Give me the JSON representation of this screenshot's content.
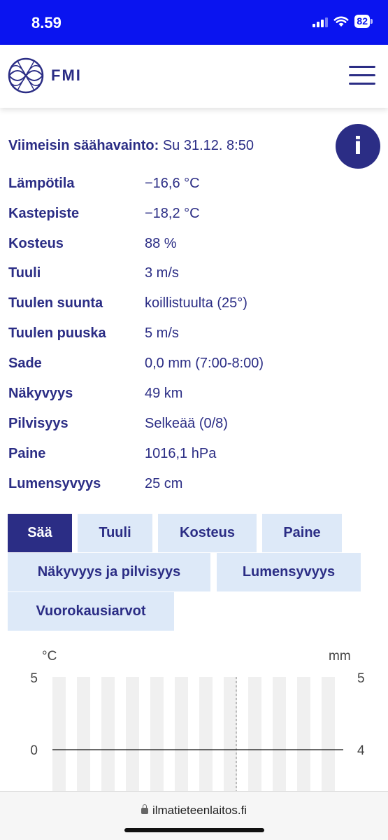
{
  "status_bar": {
    "time": "8.59",
    "battery": "82"
  },
  "header": {
    "logo_text": "FMI"
  },
  "observation": {
    "title_label": "Viimeisin säähavainto:",
    "title_value": "Su 31.12. 8:50",
    "rows": [
      {
        "label": "Lämpötila",
        "value": "−16,6 °C"
      },
      {
        "label": "Kastepiste",
        "value": "−18,2 °C"
      },
      {
        "label": "Kosteus",
        "value": "88 %"
      },
      {
        "label": "Tuuli",
        "value": "3 m/s"
      },
      {
        "label": "Tuulen suunta",
        "value": "koillistuulta (25°)"
      },
      {
        "label": "Tuulen puuska",
        "value": "5 m/s"
      },
      {
        "label": "Sade",
        "value": "0,0 mm (7:00-8:00)"
      },
      {
        "label": "Näkyvyys",
        "value": "49 km"
      },
      {
        "label": "Pilvisyys",
        "value": "Selkeää (0/8)"
      },
      {
        "label": "Paine",
        "value": "1016,1 hPa"
      },
      {
        "label": "Lumensyvyys",
        "value": "25 cm"
      }
    ]
  },
  "tabs": [
    {
      "label": "Sää",
      "active": true
    },
    {
      "label": "Tuuli",
      "active": false
    },
    {
      "label": "Kosteus",
      "active": false
    },
    {
      "label": "Paine",
      "active": false
    },
    {
      "label": "Näkyvyys ja pilvisyys",
      "active": false
    },
    {
      "label": "Lumensyvyys",
      "active": false
    },
    {
      "label": "Vuorokausiarvot",
      "active": false
    }
  ],
  "chart_data": {
    "type": "line",
    "left_unit": "°C",
    "right_unit": "mm",
    "left_ticks": [
      "5",
      "0"
    ],
    "right_ticks": [
      "5",
      "4"
    ],
    "series": []
  },
  "browser": {
    "url": "ilmatieteenlaitos.fi"
  },
  "colors": {
    "brand": "#2b2d85",
    "status_bar": "#0a14f0",
    "tab_inactive": "#dde9f8"
  }
}
